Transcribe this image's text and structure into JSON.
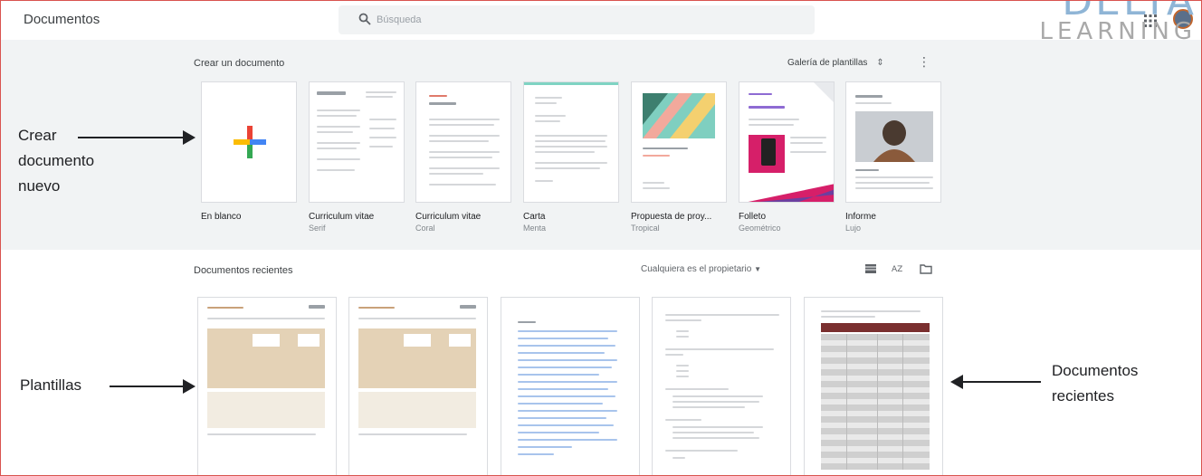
{
  "header": {
    "app_title": "Documentos",
    "search_placeholder": "Búsqueda"
  },
  "logo": {
    "line1": "DELTA",
    "line2": "LEARNING"
  },
  "templates": {
    "section_title": "Crear un documento",
    "gallery_label": "Galería de plantillas",
    "items": [
      {
        "name": "En blanco",
        "sub": ""
      },
      {
        "name": "Curriculum vitae",
        "sub": "Serif"
      },
      {
        "name": "Curriculum vitae",
        "sub": "Coral"
      },
      {
        "name": "Carta",
        "sub": "Menta"
      },
      {
        "name": "Propuesta de proy...",
        "sub": "Tropical"
      },
      {
        "name": "Folleto",
        "sub": "Geométrico"
      },
      {
        "name": "Informe",
        "sub": "Lujo"
      }
    ]
  },
  "recent": {
    "section_title": "Documentos recientes",
    "owner_filter": "Cualquiera es el propietario"
  },
  "annotations": {
    "crear": [
      "Crear",
      "documento",
      "nuevo"
    ],
    "plantillas": "Plantillas",
    "recientes": [
      "Documentos",
      "recientes"
    ]
  },
  "colors": {
    "accent_blue": "#4285f4",
    "red": "#ea4335",
    "yellow": "#fbbc04",
    "green": "#34a853",
    "frame": "#d9534f"
  }
}
